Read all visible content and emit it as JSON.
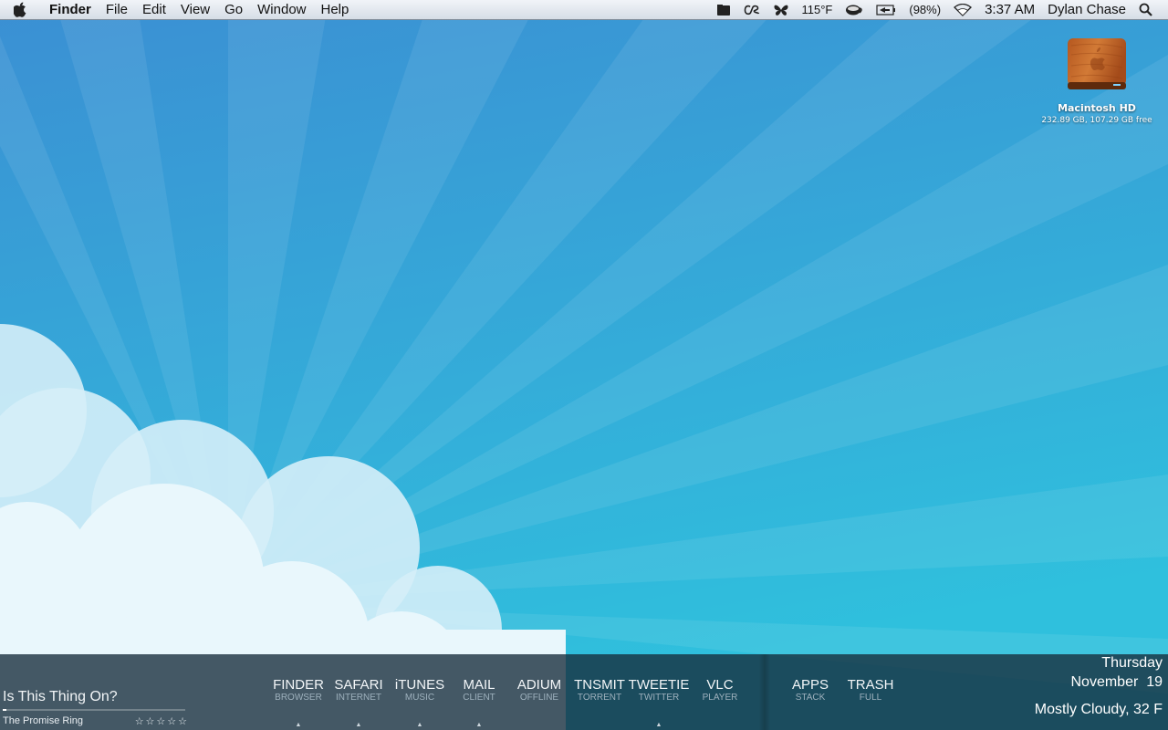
{
  "menubar": {
    "apple_icon": "apple-icon",
    "app_name": "Finder",
    "menus": [
      "File",
      "Edit",
      "View",
      "Go",
      "Window",
      "Help"
    ],
    "status": {
      "temperature": "115°F",
      "battery": "(98%)",
      "clock": "3:37 AM",
      "user": "Dylan Chase"
    }
  },
  "desktop": {
    "hd_name": "Macintosh HD",
    "hd_info": "232.89 GB, 107.29 GB free"
  },
  "now_playing": {
    "title": "Is This Thing On?",
    "artist": "The Promise Ring",
    "stars": "☆☆☆☆☆",
    "progress": 0.02
  },
  "dock": [
    {
      "name": "FINDER",
      "sub": "BROWSER",
      "running": true
    },
    {
      "name": "SAFARI",
      "sub": "INTERNET",
      "running": true
    },
    {
      "name": "iTUNES",
      "sub": "MUSIC",
      "running": true
    },
    {
      "name": "MAIL",
      "sub": "CLIENT",
      "running": true
    },
    {
      "name": "ADIUM",
      "sub": "OFFLINE",
      "running": false
    },
    {
      "name": "TNSMIT",
      "sub": "TORRENT",
      "running": false
    },
    {
      "name": "TWEETIE",
      "sub": "TWITTER",
      "running": true
    },
    {
      "name": "VLC",
      "sub": "PLAYER",
      "running": false
    },
    {
      "name": "APPS",
      "sub": "STACK",
      "running": false
    },
    {
      "name": "TRASH",
      "sub": "FULL",
      "running": false
    }
  ],
  "weather": {
    "day": "Thursday",
    "date": "November  19",
    "condition": "Mostly Cloudy, 32 F"
  },
  "colors": {
    "sky_top": "#3b8fd3",
    "sky_bottom": "#2fc0dd",
    "ray": "#ffffff",
    "cloud": "#e6f6fc",
    "bar": "#162c3a"
  }
}
